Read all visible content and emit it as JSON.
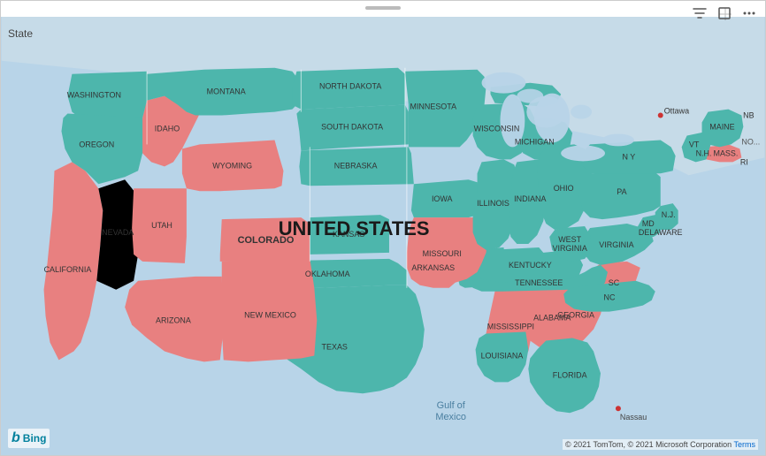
{
  "toolbar": {
    "filter_icon": "⊿",
    "expand_icon": "⊡",
    "more_icon": "…"
  },
  "header": {
    "state_label": "State"
  },
  "map": {
    "title": "UNITED STATES",
    "colors": {
      "teal": "#4db6ac",
      "salmon": "#e88080",
      "water": "#b8d4e8",
      "canada": "#c8dce8"
    },
    "states": {
      "washington": "WASHINGTON",
      "oregon": "OREGON",
      "california": "CALIFORNIA",
      "nevada": "NEVADA",
      "idaho": "IDAHO",
      "montana": "MONTANA",
      "wyoming": "WYOMING",
      "utah": "UTAH",
      "arizona": "ARIZONA",
      "colorado": "COLORADO",
      "new_mexico": "NEW MEXICO",
      "north_dakota": "NORTH DAKOTA",
      "south_dakota": "SOUTH DAKOTA",
      "nebraska": "NEBRASKA",
      "kansas": "KANSAS",
      "oklahoma": "OKLAHOMA",
      "texas": "TEXAS",
      "minnesota": "MINNESOTA",
      "iowa": "IOWA",
      "missouri": "MISSOURI",
      "arkansas": "ARKANSAS",
      "louisiana": "LOUISIANA",
      "wisconsin": "WISCONSIN",
      "illinois": "ILLINOIS",
      "michigan": "MICHIGAN",
      "indiana": "INDIANA",
      "kentucky": "KENTUCKY",
      "tennessee": "TENNESSEE",
      "mississippi": "MISSISSIPPI",
      "alabama": "ALABAMA",
      "ohio": "OHIO",
      "georgia": "GEORGIA",
      "florida": "FLORIDA",
      "south_carolina": "SC",
      "north_carolina": "NC",
      "virginia": "VIRGINIA",
      "west_virginia": "WEST VIRGINIA",
      "pennsylvania": "PA",
      "new_york": "N Y",
      "maryland": "MD",
      "delaware": "DELAWARE",
      "new_jersey": "N.J.",
      "vermont": "VT",
      "new_hampshire": "N.H.",
      "maine": "MAINE",
      "massachusetts": "MASS.",
      "rhode_island": "RI",
      "connecticut": "",
      "gulf_of_mexico": "Gulf of\nMexico",
      "ottawa": "Ottawa",
      "nb": "NB",
      "nova_scotia": "NO..."
    }
  },
  "bing": {
    "logo": "Bing"
  },
  "copyright": {
    "text": "© 2021 TomTom, © 2021 Microsoft Corporation",
    "terms_label": "Terms"
  }
}
